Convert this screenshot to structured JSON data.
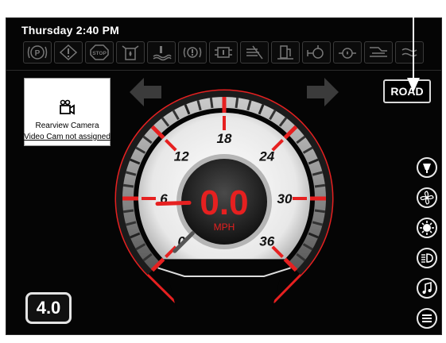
{
  "status_bar": {
    "datetime": "Thursday 2:40 PM"
  },
  "telltales": [
    {
      "icon": "parking-brake-icon",
      "label": "(P)"
    },
    {
      "icon": "warning-triangle-icon",
      "label": "!"
    },
    {
      "icon": "stop-icon",
      "label": "STOP"
    },
    {
      "icon": "fuel-filter-icon",
      "label": ""
    },
    {
      "icon": "coolant-level-icon",
      "label": ""
    },
    {
      "icon": "transmission-warning-icon",
      "label": ""
    },
    {
      "icon": "hydraulic-icon",
      "label": ""
    },
    {
      "icon": "air-filter-icon",
      "label": ""
    },
    {
      "icon": "fuel-level-icon",
      "label": ""
    },
    {
      "icon": "oil-pressure-icon",
      "label": ""
    },
    {
      "icon": "oil-temp-icon",
      "label": ""
    },
    {
      "icon": "battery-icon",
      "label": ""
    },
    {
      "icon": "wait-to-start-icon",
      "label": ""
    }
  ],
  "camera": {
    "title": "Rearview Camera",
    "subtitle": "Video Cam not assigned"
  },
  "mode_button": {
    "label": "ROAD"
  },
  "speedometer": {
    "speed": "0.0",
    "unit": "MPH",
    "ticks": [
      "0",
      "6",
      "12",
      "18",
      "24",
      "30",
      "36"
    ],
    "max": 36,
    "value": 0.0
  },
  "odometer": {
    "value": "4.0"
  },
  "side_buttons": [
    {
      "icon": "wiper-icon"
    },
    {
      "icon": "fan-icon"
    },
    {
      "icon": "brightness-icon"
    },
    {
      "icon": "headlight-icon"
    },
    {
      "icon": "music-icon"
    },
    {
      "icon": "menu-icon"
    }
  ],
  "colors": {
    "accent": "#e62020",
    "background": "#050505",
    "tick_gray": "#8c8c8c"
  }
}
